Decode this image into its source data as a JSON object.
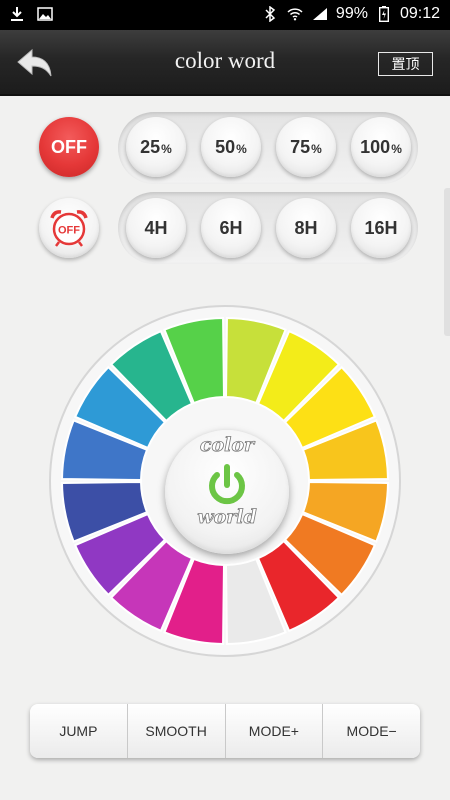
{
  "status_bar": {
    "battery": "99%",
    "time": "09:12",
    "left_icons": [
      "download-icon",
      "image-icon"
    ],
    "right_icons": [
      "bluetooth-icon",
      "wifi-icon",
      "signal-icon",
      "battery-icon"
    ]
  },
  "header": {
    "title": "color word",
    "pin_label": "置顶",
    "back_icon": "back-arrow-icon"
  },
  "brightness": {
    "off_label": "OFF",
    "levels": [
      {
        "value": "25",
        "unit": "%"
      },
      {
        "value": "50",
        "unit": "%"
      },
      {
        "value": "75",
        "unit": "%"
      },
      {
        "value": "100",
        "unit": "%"
      }
    ]
  },
  "timer": {
    "off_label": "OFF",
    "icon": "alarm-clock-icon",
    "options": [
      "4H",
      "6H",
      "8H",
      "16H"
    ]
  },
  "color_wheel": {
    "brand_top": "color",
    "brand_bottom": "world",
    "power_icon": "power-icon",
    "segments": [
      "#c7e03a",
      "#f3ec19",
      "#fde015",
      "#f8c51c",
      "#f5a623",
      "#f07a22",
      "#e9262b",
      "#eaeaea",
      "#e21f8a",
      "#c636b9",
      "#9038c3",
      "#3c4fa6",
      "#3f76c8",
      "#2e9ad6",
      "#27b58e",
      "#56d149"
    ]
  },
  "modes": [
    "JUMP",
    "SMOOTH",
    "MODE+",
    "MODE−"
  ],
  "colors": {
    "accent_red": "#e53838",
    "power_green": "#6cc545",
    "header_bg": "#262626"
  }
}
